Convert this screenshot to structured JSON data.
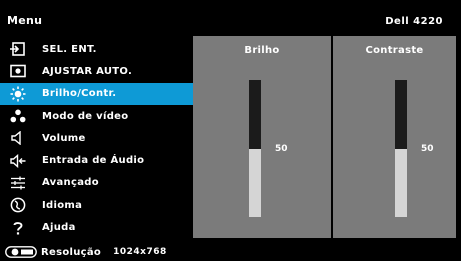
{
  "header": {
    "title": "Menu",
    "model": "Dell 4220"
  },
  "menu": {
    "items": [
      {
        "label": "SEL. ENT.",
        "icon": "input-source-icon",
        "selected": false
      },
      {
        "label": "AJUSTAR AUTO.",
        "icon": "auto-adjust-icon",
        "selected": false
      },
      {
        "label": "Brilho/Contr.",
        "icon": "brightness-icon",
        "selected": true
      },
      {
        "label": "Modo de vídeo",
        "icon": "video-mode-icon",
        "selected": false
      },
      {
        "label": "Volume",
        "icon": "volume-icon",
        "selected": false
      },
      {
        "label": "Entrada de Áudio",
        "icon": "audio-input-icon",
        "selected": false
      },
      {
        "label": "Avançado",
        "icon": "advanced-settings-icon",
        "selected": false
      },
      {
        "label": "Idioma",
        "icon": "language-icon",
        "selected": false
      },
      {
        "label": "Ajuda",
        "icon": "help-icon",
        "selected": false
      }
    ],
    "selected_color": "#0e9ad6"
  },
  "panel": {
    "brightness": {
      "title": "Brilho",
      "value": "50",
      "level": 0.5
    },
    "contrast": {
      "title": "Contraste",
      "value": "50",
      "level": 0.5
    },
    "background_color": "#7b7b7b"
  },
  "footer": {
    "icon": "display-icon",
    "label": "Resolução",
    "resolution": "1024x768"
  }
}
